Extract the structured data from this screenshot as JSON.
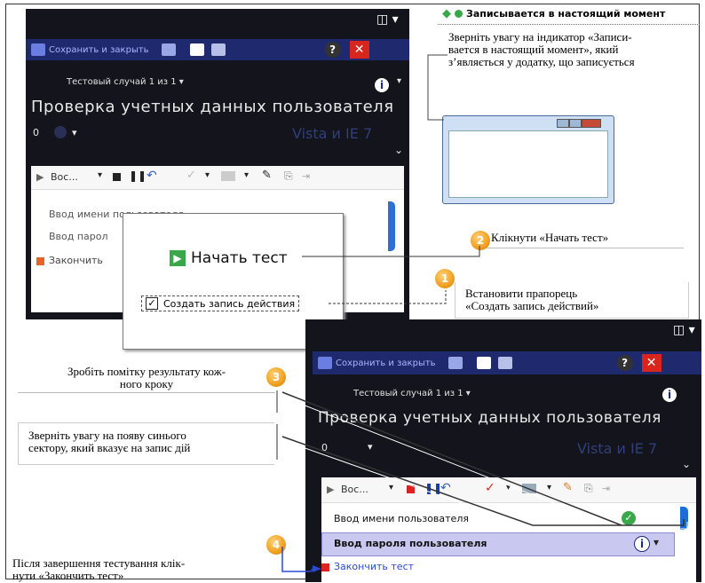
{
  "top_window": {
    "layout_icon": "◫ ▾",
    "toolbar": {
      "save_close": "Сохранить и закрыть",
      "help": "?",
      "close": "✕"
    },
    "case": "Тестовый случай 1 из 1 ▾",
    "title": "Проверка учетных данных пользователя",
    "zero": "0",
    "config": "Vista и IE 7",
    "actions_label": "Вос...",
    "steps": [
      "Ввод имени пользователя",
      "Ввод пароля пользователя"
    ],
    "steps_visible": [
      "Ввод имени пользователя",
      "Ввод парол"
    ],
    "finish": "Закончить"
  },
  "dialog": {
    "start_test": "Начать тест",
    "create_record": "Создать запись действия",
    "checkbox_checked": true
  },
  "recording": {
    "indicator": "Записывается в настоящий момент"
  },
  "bottom_window": {
    "layout_icon": "◫ ▾",
    "toolbar": {
      "save_close": "Сохранить и закрыть",
      "help": "?",
      "close": "✕"
    },
    "case": "Тестовый случай 1 из 1 ▾",
    "title": "Проверка учетных данных пользователя",
    "zero": "0",
    "config": "Vista и IE 7",
    "actions_label": "Вос...",
    "steps": [
      "Ввод имени пользователя",
      "Ввод пароля пользователя"
    ],
    "finish": "Закончить тест"
  },
  "notes": {
    "recording_note": "Зверніть увагу на індикатор «Записи-\nвается в настоящий момент», який\nз’являється у додатку, що записується",
    "step2": "Клікнути «Начать тест»",
    "step1": "Встановити прапорець\n«Создать запись действий»",
    "step3": "Зробіть помітку результату кож-\nного кроку",
    "blue_sector": "Зверніть увагу на появу синього\nсектору, який вказує на запис дій",
    "step4": "Після завершення тестування клік-\nнути «Закончить тест»"
  },
  "numbers": {
    "n1": "1",
    "n2": "2",
    "n3": "3",
    "n4": "4"
  },
  "colors": {
    "toolbar": "#1f2a6e",
    "dark": "#14141c",
    "close": "#d8261c",
    "highlight": "#c9c8f0",
    "blue_sector": "#1a6fd6"
  }
}
